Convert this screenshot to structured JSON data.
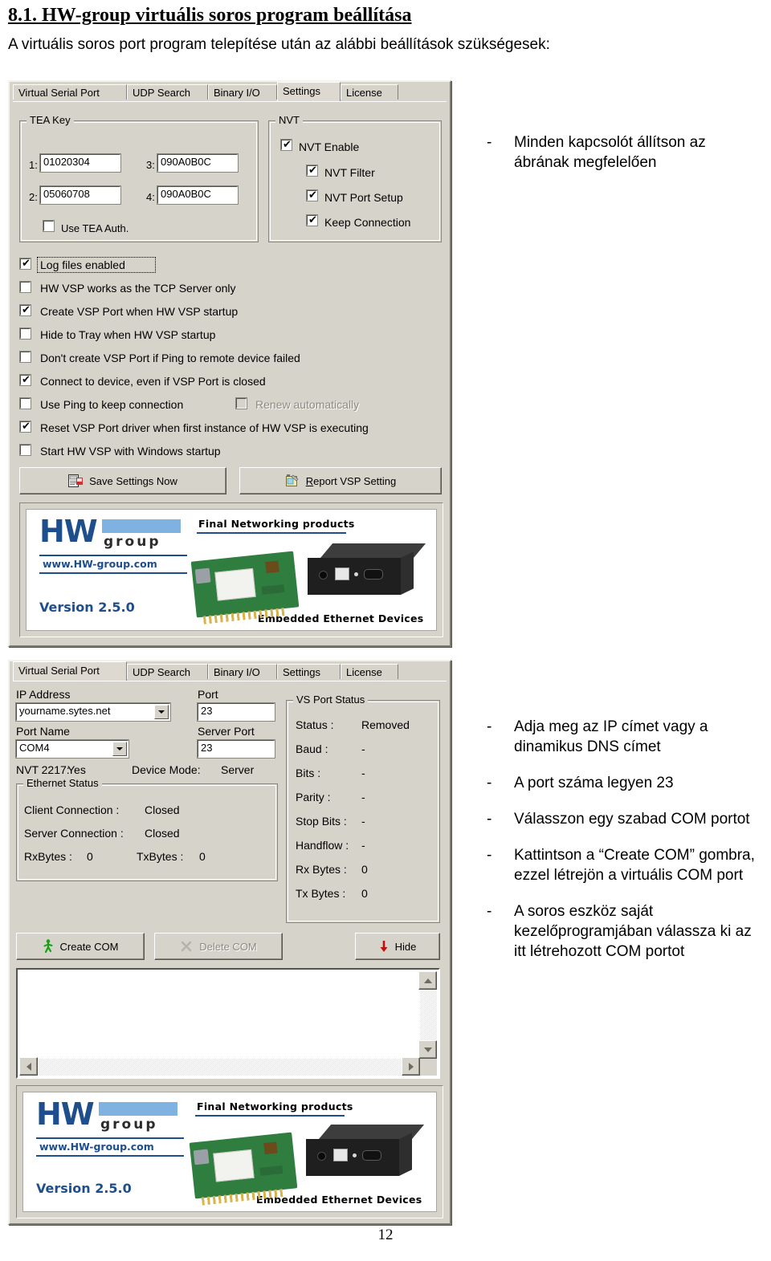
{
  "document": {
    "heading": "8.1. HW-group virtuális soros program beállítása",
    "intro": "A virtuális soros port program telepítése után az alábbi beállítások szükségesek:",
    "page_number": "12"
  },
  "settings_dialog": {
    "tabs": [
      {
        "label": "Virtual Serial Port",
        "active": false
      },
      {
        "label": "UDP Search",
        "active": false
      },
      {
        "label": "Binary I/O",
        "active": false
      },
      {
        "label": "Settings",
        "active": true
      },
      {
        "label": "License",
        "active": false
      }
    ],
    "tea_key": {
      "title": "TEA Key",
      "labels": {
        "k1": "1:",
        "k2": "2:",
        "k3": "3:",
        "k4": "4:"
      },
      "values": {
        "k1": "01020304",
        "k2": "05060708",
        "k3": "090A0B0C",
        "k4": "090A0B0C"
      },
      "use_tea_auth": {
        "label": "Use TEA Auth.",
        "checked": false
      }
    },
    "nvt": {
      "title": "NVT",
      "items": [
        {
          "label": "NVT Enable",
          "checked": true
        },
        {
          "label": "NVT Filter",
          "checked": true
        },
        {
          "label": "NVT Port Setup",
          "checked": true
        },
        {
          "label": "Keep Connection",
          "checked": true
        }
      ]
    },
    "options": [
      {
        "label": "Log files enabled",
        "checked": true,
        "focused": true,
        "disabled": false
      },
      {
        "label": "HW VSP works as the TCP Server only",
        "checked": false,
        "focused": false,
        "disabled": false
      },
      {
        "label": "Create VSP Port when HW VSP startup",
        "checked": true,
        "focused": false,
        "disabled": false
      },
      {
        "label": "Hide to Tray when HW VSP startup",
        "checked": false,
        "focused": false,
        "disabled": false
      },
      {
        "label": "Don't create VSP Port if Ping to remote device failed",
        "checked": false,
        "focused": false,
        "disabled": false
      },
      {
        "label": "Connect to device, even if VSP Port is closed",
        "checked": true,
        "focused": false,
        "disabled": false
      },
      {
        "label": "Use Ping to keep connection",
        "checked": false,
        "focused": false,
        "disabled": false
      },
      {
        "label": "Reset VSP Port driver when first instance of HW VSP is executing",
        "checked": true,
        "focused": false,
        "disabled": false
      },
      {
        "label": "Start HW VSP with Windows startup",
        "checked": false,
        "focused": false,
        "disabled": false
      }
    ],
    "renew_automatically": {
      "label": "Renew automatically",
      "checked": false,
      "disabled": true
    },
    "buttons": {
      "save_settings": "Save Settings Now",
      "report_vsp_accesskey": "R",
      "report_vsp_rest": "eport VSP Setting"
    },
    "annotation": [
      {
        "dash": "-",
        "text": "Minden kapcsolót állítson az ábrának megfelelően"
      }
    ]
  },
  "banner": {
    "mark": "HW",
    "group": "group",
    "url": "www.HW-group.com",
    "version": "Version  2.5.0",
    "tagline_top": "Final Networking products",
    "tagline_bottom": "Embedded Ethernet Devices"
  },
  "vsp_dialog": {
    "tabs": [
      {
        "label": "Virtual Serial Port",
        "active": true
      },
      {
        "label": "UDP Search",
        "active": false
      },
      {
        "label": "Binary I/O",
        "active": false
      },
      {
        "label": "Settings",
        "active": false
      },
      {
        "label": "License",
        "active": false
      }
    ],
    "ip_address": {
      "label": "IP Address",
      "value": "yourname.sytes.net"
    },
    "port": {
      "label": "Port",
      "value": "23"
    },
    "port_name": {
      "label": "Port Name",
      "value": "COM4"
    },
    "server_port": {
      "label": "Server Port",
      "value": "23"
    },
    "nvt_2217": {
      "label": "NVT 2217:",
      "value": "Yes"
    },
    "device_mode": {
      "label": "Device Mode:",
      "value": "Server"
    },
    "ethernet_status": {
      "title": "Ethernet Status",
      "rows": [
        {
          "label": "Client Connection  :",
          "value": "Closed"
        },
        {
          "label": "Server Connection :",
          "value": "Closed"
        }
      ],
      "rx_label": "RxBytes :",
      "rx_value": "0",
      "tx_label": "TxBytes :",
      "tx_value": "0"
    },
    "vs_port_status": {
      "title": "VS Port Status",
      "rows": [
        {
          "label": "Status :",
          "value": "Removed"
        },
        {
          "label": "Baud :",
          "value": "-"
        },
        {
          "label": "Bits :",
          "value": "-"
        },
        {
          "label": "Parity :",
          "value": "-"
        },
        {
          "label": "Stop Bits :",
          "value": "-"
        },
        {
          "label": "Handflow :",
          "value": "-"
        },
        {
          "label": "Rx Bytes :",
          "value": "0"
        },
        {
          "label": "Tx Bytes :",
          "value": "0"
        }
      ]
    },
    "buttons": {
      "create_com": "Create COM",
      "delete_com": "Delete COM",
      "hide": "Hide"
    },
    "log_text": "",
    "annotation": [
      {
        "dash": "-",
        "text": "Adja meg az IP címet vagy a dinamikus DNS címet"
      },
      {
        "dash": "-",
        "text": "A port száma legyen 23"
      },
      {
        "dash": "-",
        "text": "Válasszon egy szabad COM portot"
      },
      {
        "dash": "-",
        "text": "Kattintson a “Create COM” gombra, ezzel létrejön a virtuális COM port"
      },
      {
        "dash": "-",
        "text": "A soros eszköz saját kezelőprogramjában válassza ki az itt létrehozott COM portot"
      }
    ]
  },
  "colors": {
    "dialog_face": "#d6d3ca",
    "brand_blue": "#1f4e8c",
    "accent_lightblue": "#7fb2e0",
    "green_icon": "#15a015",
    "red_icon": "#c01010"
  }
}
